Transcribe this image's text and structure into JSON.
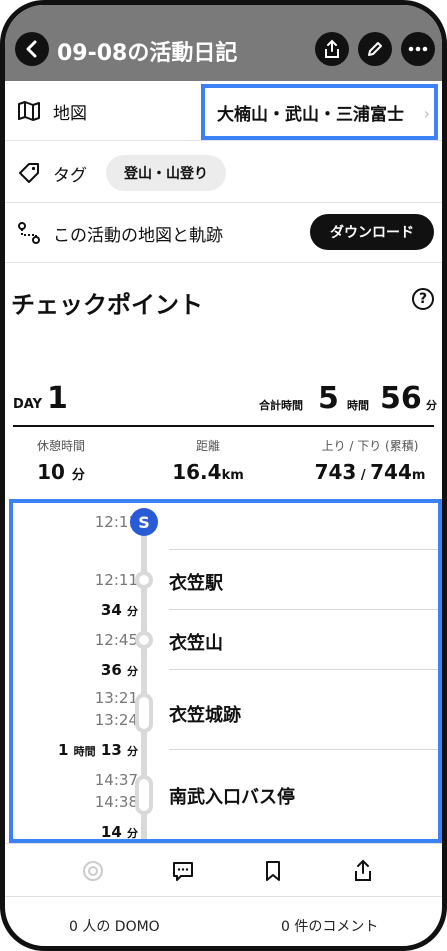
{
  "header": {
    "title": "09-08の活動日記"
  },
  "map_row": {
    "label": "地図",
    "value": "大楠山・武山・三浦富士"
  },
  "tag_row": {
    "label": "タグ",
    "chip": "登山・山登り"
  },
  "download_row": {
    "label": "この活動の地図と軌跡",
    "button": "ダウンロード"
  },
  "checkpoint": {
    "title": "チェックポイント",
    "help": "?"
  },
  "day": {
    "label": "DAY",
    "number": "1",
    "total_label": "合計時間",
    "hours": "5",
    "hours_unit": "時間",
    "minutes": "56",
    "minutes_unit": "分"
  },
  "stats": {
    "rest": {
      "label": "休憩時間",
      "value": "10",
      "unit": "分"
    },
    "distance": {
      "label": "距離",
      "value": "16.4",
      "unit": "km"
    },
    "elevation": {
      "label": "上り / 下り (累積)",
      "up": "743",
      "sep": " / ",
      "down": "744",
      "unit": "m"
    }
  },
  "timeline": {
    "start_badge": "S",
    "start_time": "12:11",
    "items": [
      {
        "time1": "12:11",
        "time2": "",
        "name": "衣笠駅",
        "dur_pre": "",
        "dur_pre_unit": "",
        "dur": "34",
        "dur_unit": "分"
      },
      {
        "time1": "12:45",
        "time2": "",
        "name": "衣笠山",
        "dur_pre": "",
        "dur_pre_unit": "",
        "dur": "36",
        "dur_unit": "分"
      },
      {
        "time1": "13:21",
        "time2": "13:24",
        "name": "衣笠城跡",
        "dur_pre": "1",
        "dur_pre_unit": "時間",
        "dur": "13",
        "dur_unit": "分"
      },
      {
        "time1": "14:37",
        "time2": "14:38",
        "name": "南武入口バス停",
        "dur_pre": "",
        "dur_pre_unit": "",
        "dur": "14",
        "dur_unit": "分"
      }
    ]
  },
  "footer": {
    "domo": "0 人の DOMO",
    "comments": "0 件のコメント"
  },
  "colors": {
    "header_bg": "#7a7a7a",
    "highlight": "#3b82f6",
    "start_badge": "#2a5bd7"
  }
}
